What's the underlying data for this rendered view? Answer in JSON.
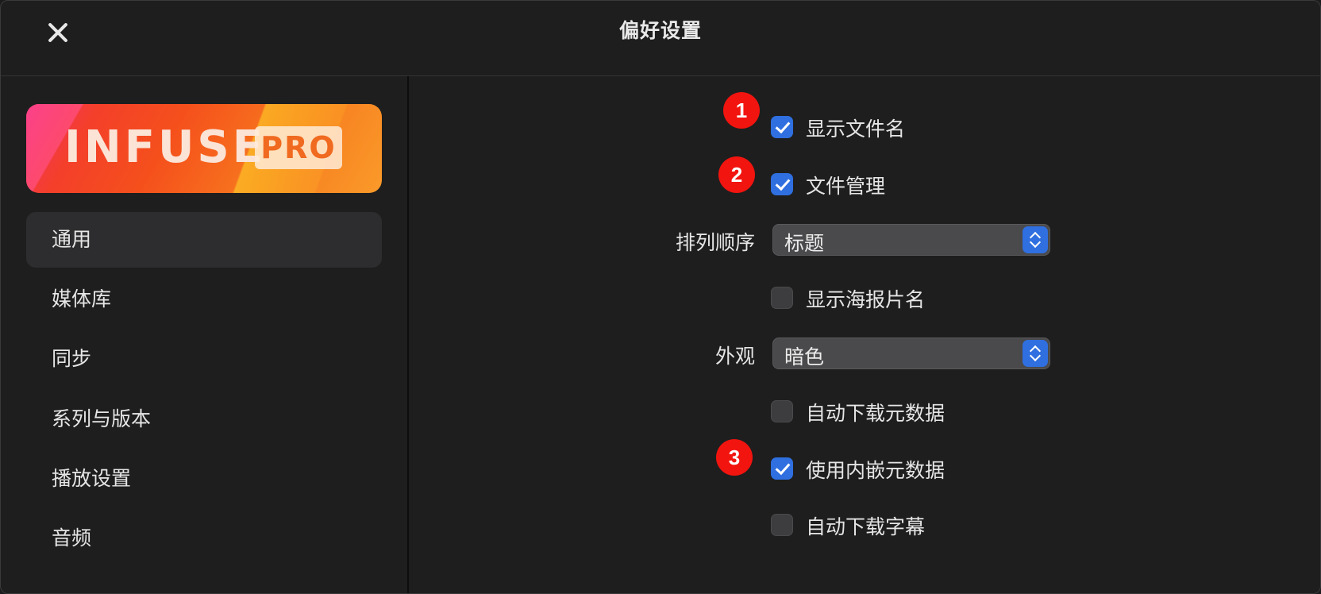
{
  "window": {
    "title": "偏好设置",
    "close_icon": "close-icon"
  },
  "logo": {
    "text": "INFUSE",
    "badge": "PRO"
  },
  "sidebar": {
    "items": [
      {
        "label": "通用",
        "active": true
      },
      {
        "label": "媒体库"
      },
      {
        "label": "同步"
      },
      {
        "label": "系列与版本"
      },
      {
        "label": "播放设置"
      },
      {
        "label": "音频"
      }
    ]
  },
  "settings": {
    "show_filename": {
      "label": "显示文件名",
      "checked": true
    },
    "file_management": {
      "label": "文件管理",
      "checked": true
    },
    "sort_order": {
      "label": "排列顺序",
      "value": "标题"
    },
    "show_poster_titles": {
      "label": "显示海报片名",
      "checked": false
    },
    "appearance": {
      "label": "外观",
      "value": "暗色"
    },
    "auto_download_metadata": {
      "label": "自动下载元数据",
      "checked": false
    },
    "use_embedded_metadata": {
      "label": "使用内嵌元数据",
      "checked": true
    },
    "auto_download_subtitles": {
      "label": "自动下载字幕",
      "checked": false
    }
  },
  "annotations": [
    "1",
    "2",
    "3"
  ],
  "colors": {
    "accent": "#2f6fe0",
    "badge": "#f2140f",
    "background": "#1e1e1e"
  }
}
